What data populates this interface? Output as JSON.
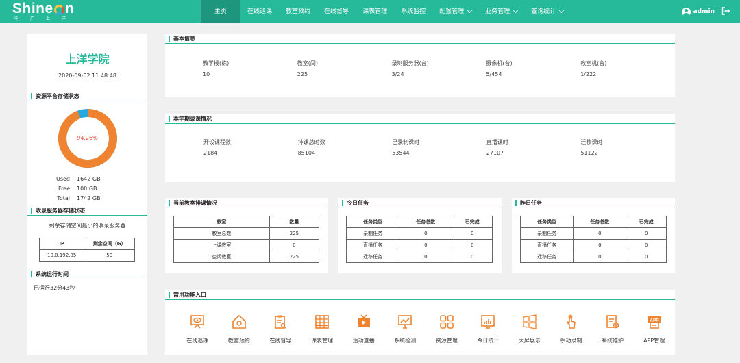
{
  "header": {
    "logo_text_left": "Shine",
    "logo_text_right": "n",
    "logo_sub": "中广上洋",
    "nav": [
      {
        "label": "主页",
        "active": true,
        "dropdown": false
      },
      {
        "label": "在线巡课",
        "active": false,
        "dropdown": false
      },
      {
        "label": "教室预约",
        "active": false,
        "dropdown": false
      },
      {
        "label": "在线督导",
        "active": false,
        "dropdown": false
      },
      {
        "label": "课表管理",
        "active": false,
        "dropdown": false
      },
      {
        "label": "系统监控",
        "active": false,
        "dropdown": false
      },
      {
        "label": "配置管理",
        "active": false,
        "dropdown": true
      },
      {
        "label": "业务管理",
        "active": false,
        "dropdown": true
      },
      {
        "label": "查询统计",
        "active": false,
        "dropdown": true
      }
    ],
    "username": "admin"
  },
  "left": {
    "school_name": "上洋学院",
    "datetime": "2020-09-02 11:48:48",
    "storage_title": "资源平台存储状态",
    "donut_label": "94.26%",
    "donut_used_fraction": 0.9426,
    "donut_colors": {
      "used": "#f0832f",
      "free": "#29a8e0"
    },
    "storage": [
      {
        "key": "Used",
        "value": "1642 GB"
      },
      {
        "key": "Free",
        "value": "100 GB"
      },
      {
        "key": "Total",
        "value": "1742 GB"
      }
    ],
    "recorder_title": "收录服务器存储状态",
    "recorder_note": "剩余存储空间最小的收录服务器",
    "recorder_table": {
      "headers": [
        "IP",
        "剩余空间（G）"
      ],
      "rows": [
        [
          "10.0.192.85",
          "50"
        ]
      ]
    },
    "uptime_title": "系统运行时间",
    "uptime_text": "已运行32分43秒"
  },
  "basic": {
    "title": "基本信息",
    "items": [
      {
        "label": "教学楼(栋)",
        "value": "10"
      },
      {
        "label": "教室(间)",
        "value": "225"
      },
      {
        "label": "录制服务器(台)",
        "value": "3/24"
      },
      {
        "label": "摄像机(台)",
        "value": "5/454"
      },
      {
        "label": "教室机(台)",
        "value": "1/222"
      }
    ]
  },
  "semester": {
    "title": "本学期录课情况",
    "items": [
      {
        "label": "开设课程数",
        "value": "2184"
      },
      {
        "label": "排课总时数",
        "value": "85104"
      },
      {
        "label": "已录制课时",
        "value": "53544"
      },
      {
        "label": "直播课时",
        "value": "27107"
      },
      {
        "label": "迁移课时",
        "value": "51122"
      }
    ]
  },
  "classroom": {
    "title": "当前教室排课情况",
    "headers": [
      "教室",
      "数量"
    ],
    "rows": [
      [
        "教室总数",
        "225"
      ],
      [
        "上课教室",
        "0"
      ],
      [
        "空闲教室",
        "225"
      ]
    ]
  },
  "today": {
    "title": "今日任务",
    "headers": [
      "任务类型",
      "任务总数",
      "已完成"
    ],
    "rows": [
      [
        "录制任务",
        "0",
        "0"
      ],
      [
        "直播任务",
        "0",
        "0"
      ],
      [
        "迁移任务",
        "0",
        "0"
      ]
    ]
  },
  "yesterday": {
    "title": "昨日任务",
    "headers": [
      "任务类型",
      "任务总数",
      "已完成"
    ],
    "rows": [
      [
        "录制任务",
        "0",
        "0"
      ],
      [
        "直播任务",
        "0",
        "0"
      ],
      [
        "迁移任务",
        "0",
        "0"
      ]
    ]
  },
  "functions": {
    "title": "常用功能入口",
    "items": [
      {
        "label": "在线巡课",
        "icon": "eye-board-icon"
      },
      {
        "label": "教室预约",
        "icon": "house-icon"
      },
      {
        "label": "在线督导",
        "icon": "clipboard-icon"
      },
      {
        "label": "课表管理",
        "icon": "table-icon"
      },
      {
        "label": "活动直播",
        "icon": "tv-play-icon"
      },
      {
        "label": "系统检测",
        "icon": "monitor-chart-icon"
      },
      {
        "label": "资源管理",
        "icon": "grid-icon"
      },
      {
        "label": "今日统计",
        "icon": "bar-chart-icon"
      },
      {
        "label": "大屏展示",
        "icon": "windows-icon"
      },
      {
        "label": "手动录制",
        "icon": "hand-pointer-icon"
      },
      {
        "label": "系统维护",
        "icon": "settings-doc-icon"
      },
      {
        "label": "APP管理",
        "icon": "app-icon"
      }
    ],
    "icon_color": "#f0832f"
  }
}
